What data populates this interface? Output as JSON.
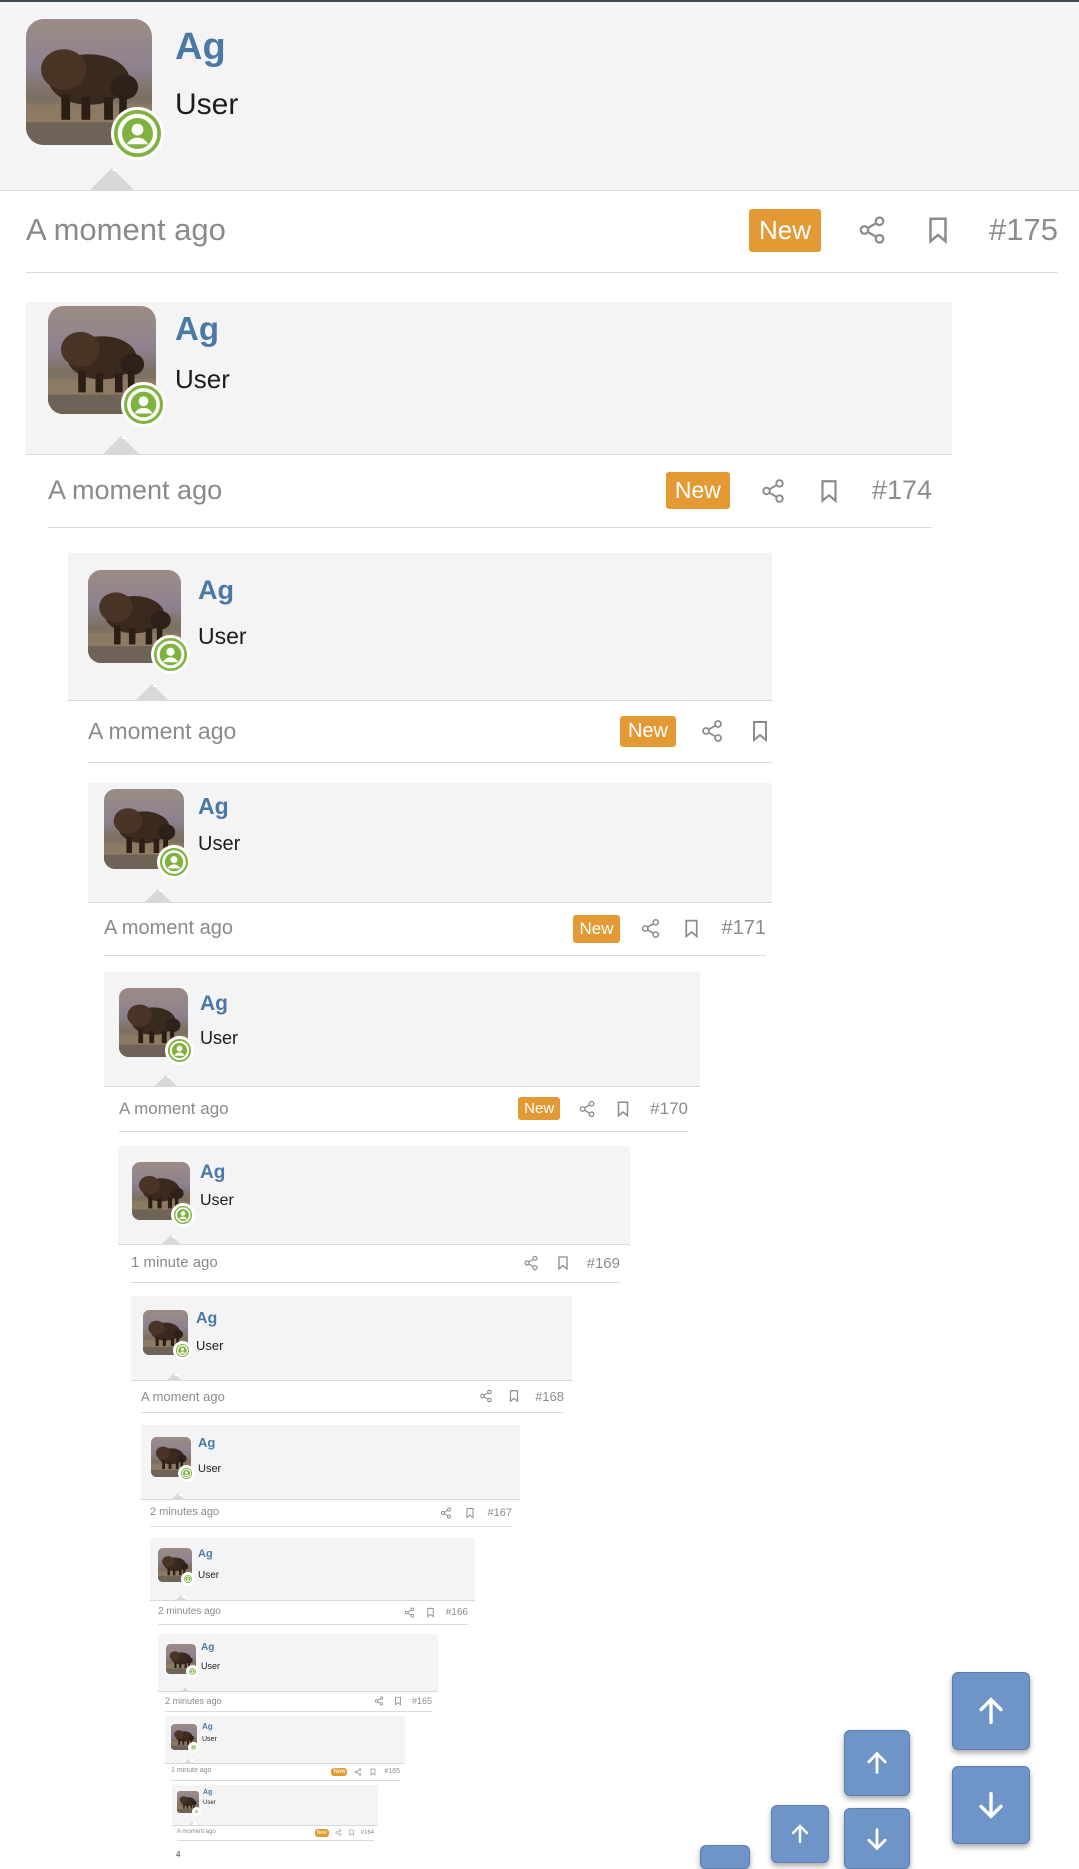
{
  "user": {
    "name": "Ag",
    "title": "User"
  },
  "colors": {
    "accent": "#4a79a6",
    "badge": "#e39a34",
    "online": "#7fb23f",
    "fab": "#6f94c7"
  },
  "icons": {
    "share": "share-icon",
    "bookmark": "bookmark-icon",
    "online": "user-online-icon",
    "up": "arrow-up-icon",
    "down": "arrow-down-icon"
  },
  "posts": [
    {
      "time": "A moment ago",
      "badge": "New",
      "num": "#175"
    },
    {
      "time": "A moment ago",
      "badge": "New",
      "num": "#174"
    },
    {
      "time": "A moment ago",
      "badge": "New",
      "num": ""
    },
    {
      "time": "A moment ago",
      "badge": "New",
      "num": "#171"
    },
    {
      "time": "A moment ago",
      "badge": "New",
      "num": "#170"
    },
    {
      "time": "1 minute ago",
      "badge": "",
      "num": "#169"
    },
    {
      "time": "A moment ago",
      "badge": "",
      "num": "#168"
    },
    {
      "time": "2 minutes ago",
      "badge": "",
      "num": "#167"
    },
    {
      "time": "2 minutes ago",
      "badge": "",
      "num": "#166"
    },
    {
      "time": "2 minutes ago",
      "badge": "",
      "num": "#165"
    },
    {
      "time": "1 minute ago",
      "badge": "New",
      "num": "#165"
    },
    {
      "time": "A moment ago",
      "badge": "New",
      "num": "#164"
    }
  ],
  "footer_number": "4"
}
